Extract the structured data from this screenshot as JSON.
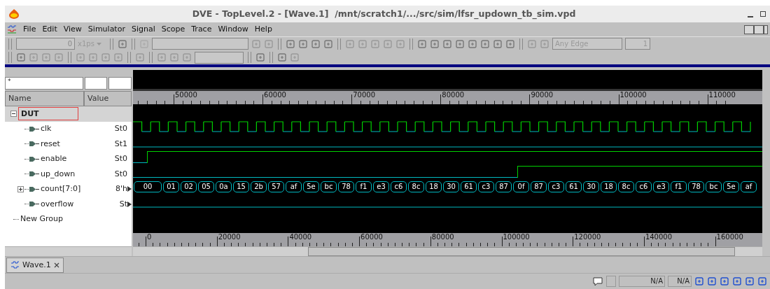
{
  "title_bar": {
    "title": "DVE - TopLevel.2 - [Wave.1]  /mnt/scratch1/.../src/sim/lfsr_updown_tb_sim.vpd"
  },
  "menu": [
    {
      "label": "File"
    },
    {
      "label": "Edit"
    },
    {
      "label": "View"
    },
    {
      "label": "Simulator"
    },
    {
      "label": "Signal"
    },
    {
      "label": "Scope"
    },
    {
      "label": "Trace"
    },
    {
      "label": "Window"
    },
    {
      "label": "Help"
    }
  ],
  "toolbar": {
    "time_value": "0",
    "time_unit": "x1ps",
    "edge_type": "Any Edge",
    "edge_count": "1"
  },
  "signal_filter": {
    "value": "*"
  },
  "signal_tree": {
    "columns": [
      "Name",
      "Value"
    ],
    "items": [
      {
        "name": "DUT",
        "kind": "scope",
        "selected": true,
        "expanded": true,
        "children": [
          {
            "name": "clk",
            "kind": "clock",
            "value": "St0",
            "truncated": false
          },
          {
            "name": "reset",
            "kind": "constant",
            "value": "St1",
            "truncated": false
          },
          {
            "name": "enable",
            "kind": "step",
            "value": "St0",
            "truncated": false,
            "level": 0.978
          },
          {
            "name": "up_down",
            "kind": "step",
            "value": "St0",
            "truncated": false,
            "level": 0.389
          },
          {
            "name": "count[7:0]",
            "kind": "bus",
            "value": "8'h",
            "truncated": true,
            "expanded": false,
            "segments": [
              "00",
              "01",
              "02",
              "05",
              "0a",
              "15",
              "2b",
              "57",
              "af",
              "5e",
              "bc",
              "78",
              "f1",
              "e3",
              "c6",
              "8c",
              "18",
              "30",
              "61",
              "c3",
              "87",
              "0f",
              "87",
              "c3",
              "61",
              "30",
              "18",
              "8c",
              "c6",
              "e3",
              "f1",
              "78",
              "bc",
              "5e",
              "af"
            ]
          },
          {
            "name": "overflow",
            "kind": "constant",
            "value": "St",
            "truncated": true
          }
        ]
      },
      {
        "name": "New Group",
        "kind": "group"
      }
    ]
  },
  "top_ruler": [
    "50000",
    "60000",
    "70000",
    "80000",
    "90000",
    "100000",
    "110000"
  ],
  "bottom_ruler": [
    "0",
    "20000",
    "40000",
    "60000",
    "80000",
    "100000",
    "120000",
    "140000",
    "160000"
  ],
  "tabs": [
    {
      "label": "Wave.1",
      "selected": true
    }
  ],
  "status_bar": {
    "fields": [
      "N/A",
      "N/A"
    ]
  }
}
